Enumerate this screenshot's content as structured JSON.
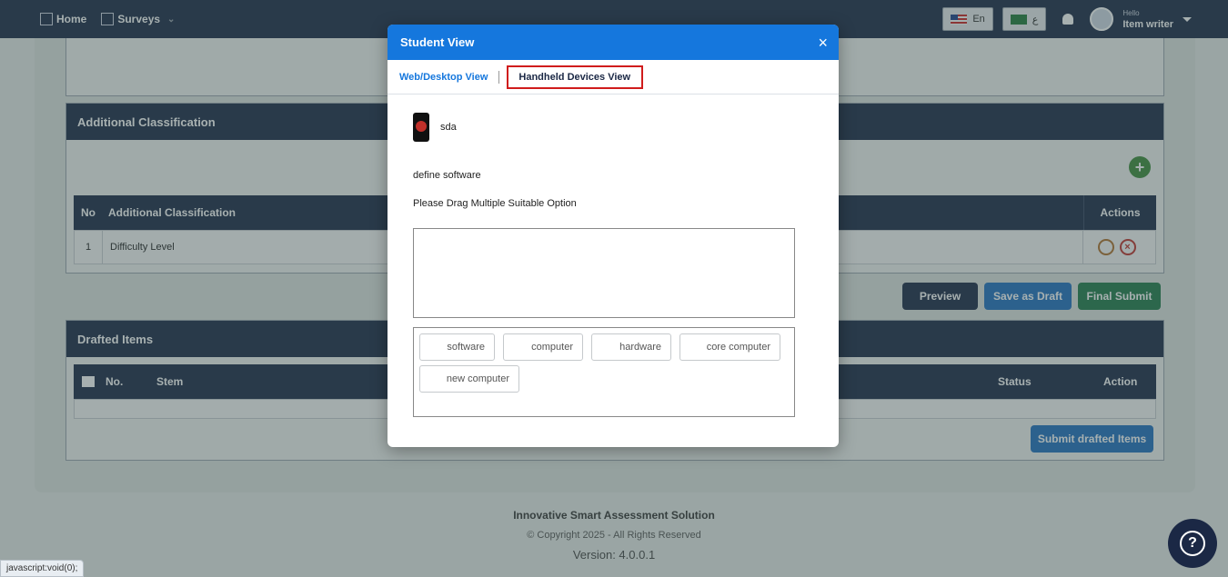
{
  "navbar": {
    "home": "Home",
    "surveys": "Surveys",
    "lang_en": "En",
    "lang_ar": "ع",
    "hello": "Hello",
    "user_name": "Item writer"
  },
  "background": {
    "additional_classification": {
      "title": "Additional Classification",
      "headers": [
        "No",
        "Additional Classification",
        "Actions"
      ],
      "rows": [
        {
          "no": "1",
          "name": "Difficulty Level"
        }
      ]
    },
    "buttons": {
      "preview": "Preview",
      "save_draft": "Save as Draft",
      "final_submit": "Final Submit"
    },
    "drafted_items": {
      "title": "Drafted Items",
      "headers": [
        "No.",
        "Stem",
        "Status",
        "Action"
      ],
      "submit": "Submit drafted Items"
    },
    "footer": {
      "title": "Innovative Smart Assessment Solution",
      "copyright": "© Copyright 2025 - All Rights Reserved",
      "version": "Version: 4.0.0.1"
    },
    "status_bar": "javascript:void(0);"
  },
  "modal": {
    "title": "Student View",
    "close": "×",
    "tabs": {
      "web": "Web/Desktop View",
      "handheld": "Handheld Devices View"
    },
    "logo_text": "sda",
    "question": "define software",
    "instruction": "Please Drag Multiple Suitable Option",
    "options": [
      "software",
      "computer",
      "hardware",
      "core computer",
      "new computer"
    ]
  },
  "colors": {
    "navy": "#1b2845",
    "accent_blue": "#1577dd",
    "highlight_red": "#d01c1c",
    "submit_green": "#1f7a4a"
  }
}
